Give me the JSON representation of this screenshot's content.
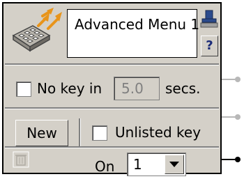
{
  "header": {
    "title": "Advanced Menu 1",
    "help_label": "?"
  },
  "timeout": {
    "checkbox_label": "No key in",
    "value": "5.0",
    "unit": "secs.",
    "checked": false
  },
  "keys": {
    "new_label": "New",
    "unlisted_label": "Unlisted key",
    "unlisted_checked": false
  },
  "footer": {
    "on_label": "On",
    "on_value": "1"
  },
  "icons": [
    "menu-node-icon",
    "pin-icon",
    "trash-icon",
    "chevron-down-icon"
  ],
  "colors": {
    "panel": "#d4d0c8",
    "connector_inactive": "#b8b8b8",
    "connector_active": "#000000"
  }
}
